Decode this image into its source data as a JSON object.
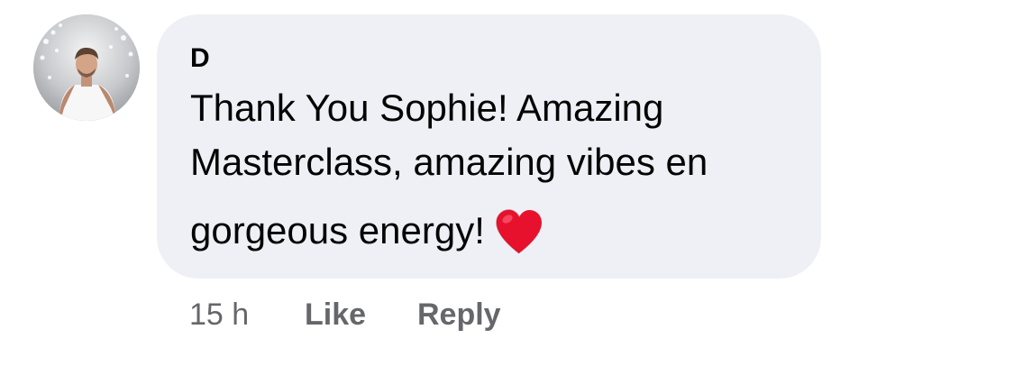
{
  "comment": {
    "author": "D",
    "avatar_icon": "profile-photo",
    "text_lines": [
      "Thank You Sophie! Amazing",
      "Masterclass, amazing vibes en",
      "gorgeous energy!"
    ],
    "emoji": "red-heart-icon",
    "bubble_color": "#eff0f5",
    "heart_color": "#e8112d"
  },
  "actions": {
    "timestamp": "15 h",
    "like_label": "Like",
    "reply_label": "Reply"
  }
}
